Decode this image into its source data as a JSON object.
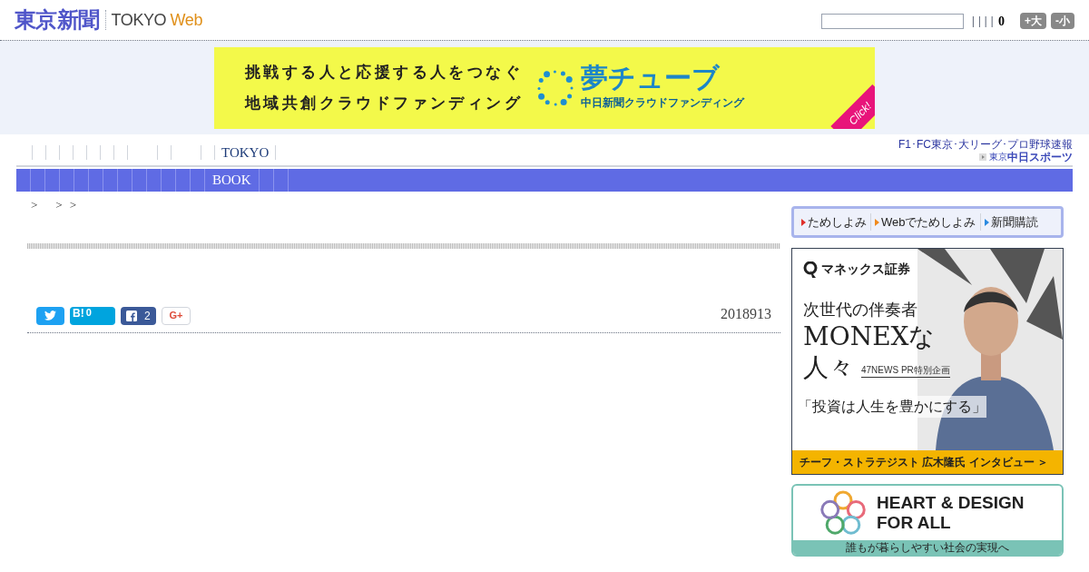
{
  "header": {
    "logo_jp": "東京新聞",
    "logo_en": "TOKYO",
    "logo_web": "Web",
    "bars": "| | | |",
    "count": "0",
    "buttons": [
      "+大",
      "-小"
    ]
  },
  "top_banner": {
    "lines": [
      "挑戦する人と応援する人をつなぐ",
      "地域共創クラウドファンディング"
    ],
    "brand": "夢チューブ",
    "brand_sub": "中日新聞クラウドファンディング",
    "corner": "Click!"
  },
  "nav_top": {
    "label": "TOKYO"
  },
  "sports_link": {
    "line1": "F1･FC東京･大リーグ･プロ野球速報",
    "prefix": "東京",
    "name": "中日スポーツ"
  },
  "nav_main": {
    "label": "BOOK"
  },
  "breadcrumb": [
    ">",
    ">",
    ">"
  ],
  "share": [
    {
      "kind": "twitter"
    },
    {
      "kind": "hatena",
      "label": "B!",
      "count": "0"
    },
    {
      "kind": "facebook",
      "count": "2"
    },
    {
      "kind": "google",
      "label": "G+"
    }
  ],
  "date": "2018913",
  "subscribe_tabs": [
    {
      "label": "ためしよみ",
      "color": "#e0302a"
    },
    {
      "label": "Webでためしよみ",
      "color": "#f08a1c"
    },
    {
      "label": "新聞購読",
      "color": "#2a8ae0"
    }
  ],
  "monex_ad": {
    "brand": "マネックス証券",
    "lines": [
      "次世代の伴奏者",
      "MONEXな",
      "人々"
    ],
    "tag": "47NEWS PR特別企画",
    "quote": "「投資は人生を豊かにする」",
    "footer": "チーフ・ストラテジスト 広木隆氏 インタビュー ＞"
  },
  "heart_ad": {
    "title1": "HEART & DESIGN",
    "title2": "FOR ALL",
    "footer": "誰もが暮らしやすい社会の実現へ"
  }
}
